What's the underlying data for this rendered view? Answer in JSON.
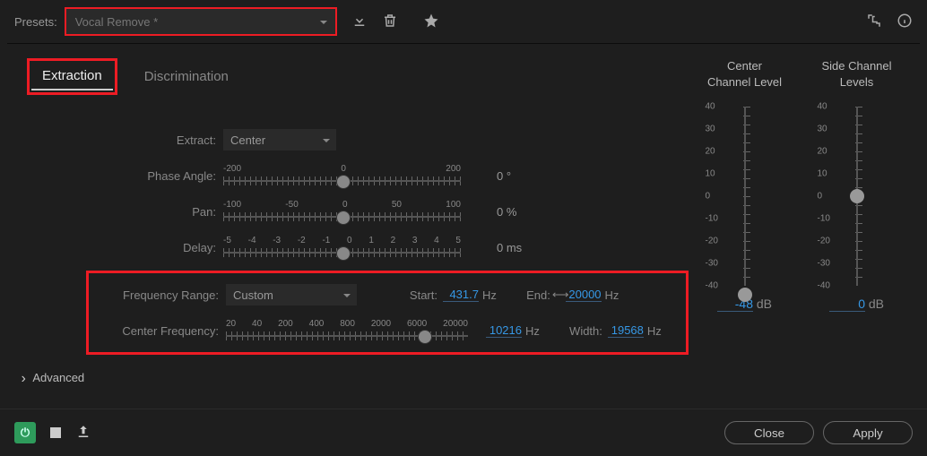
{
  "header": {
    "presets_label": "Presets:",
    "preset_name": "Vocal Remove *",
    "icons": [
      "import-icon",
      "trash-icon",
      "star-icon",
      "routing-icon",
      "info-icon"
    ]
  },
  "tabs": {
    "extraction": "Extraction",
    "discrimination": "Discrimination"
  },
  "extract": {
    "label": "Extract:",
    "value": "Center"
  },
  "phase": {
    "label": "Phase Angle:",
    "ticks": [
      "-200",
      "0",
      "200"
    ],
    "value": "0 °"
  },
  "pan": {
    "label": "Pan:",
    "ticks": [
      "-100",
      "-50",
      "0",
      "50",
      "100"
    ],
    "value": "0 %"
  },
  "delay": {
    "label": "Delay:",
    "ticks": [
      "-5",
      "-4",
      "-3",
      "-2",
      "-1",
      "0",
      "1",
      "2",
      "3",
      "4",
      "5"
    ],
    "value": "0 ms"
  },
  "freq_range": {
    "label": "Frequency Range:",
    "value": "Custom"
  },
  "start": {
    "label": "Start:",
    "value": "431.7",
    "unit": "Hz"
  },
  "end": {
    "label": "End:",
    "value": "20000",
    "unit": "Hz"
  },
  "center_freq": {
    "label": "Center Frequency:",
    "ticks": [
      "20",
      "40",
      "200",
      "400",
      "800",
      "2000",
      "6000",
      "20000"
    ],
    "value": "10216",
    "unit": "Hz"
  },
  "width": {
    "label": "Width:",
    "value": "19568",
    "unit": "Hz"
  },
  "advanced": "Advanced",
  "channels": {
    "center": {
      "title": "Center Channel Level",
      "ticks": [
        "40",
        "30",
        "20",
        "10",
        "0",
        "-10",
        "-20",
        "-30",
        "-40"
      ],
      "value": "-48",
      "unit": "dB"
    },
    "side": {
      "title": "Side Channel Levels",
      "ticks": [
        "40",
        "30",
        "20",
        "10",
        "0",
        "-10",
        "-20",
        "-30",
        "-40"
      ],
      "value": "0",
      "unit": "dB"
    }
  },
  "footer": {
    "close": "Close",
    "apply": "Apply"
  }
}
